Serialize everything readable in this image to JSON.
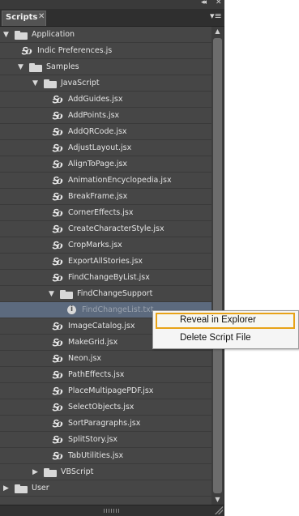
{
  "panel": {
    "tab_label": "Scripts",
    "tab_close_icon": "close-icon",
    "collapse_icon": "double-chevron-left-icon",
    "menu_icon": "panel-menu-icon"
  },
  "tree": {
    "rows": [
      {
        "label": "Application",
        "type": "folder",
        "expanded": true,
        "depth": 0
      },
      {
        "label": "Indic Preferences.js",
        "type": "script",
        "depth": 1
      },
      {
        "label": "Samples",
        "type": "folder",
        "expanded": true,
        "depth": 1
      },
      {
        "label": "JavaScript",
        "type": "folder",
        "expanded": true,
        "depth": 2
      },
      {
        "label": "AddGuides.jsx",
        "type": "script",
        "depth": 3
      },
      {
        "label": "AddPoints.jsx",
        "type": "script",
        "depth": 3
      },
      {
        "label": "AddQRCode.jsx",
        "type": "script",
        "depth": 3
      },
      {
        "label": "AdjustLayout.jsx",
        "type": "script",
        "depth": 3
      },
      {
        "label": "AlignToPage.jsx",
        "type": "script",
        "depth": 3
      },
      {
        "label": "AnimationEncyclopedia.jsx",
        "type": "script",
        "depth": 3
      },
      {
        "label": "BreakFrame.jsx",
        "type": "script",
        "depth": 3
      },
      {
        "label": "CornerEffects.jsx",
        "type": "script",
        "depth": 3
      },
      {
        "label": "CreateCharacterStyle.jsx",
        "type": "script",
        "depth": 3
      },
      {
        "label": "CropMarks.jsx",
        "type": "script",
        "depth": 3
      },
      {
        "label": "ExportAllStories.jsx",
        "type": "script",
        "depth": 3
      },
      {
        "label": "FindChangeByList.jsx",
        "type": "script",
        "depth": 3
      },
      {
        "label": "FindChangeSupport",
        "type": "folder",
        "expanded": true,
        "depth": 3
      },
      {
        "label": "FindChangeList.txt",
        "type": "info",
        "depth": 4,
        "selected": true
      },
      {
        "label": "ImageCatalog.jsx",
        "type": "script",
        "depth": 3
      },
      {
        "label": "MakeGrid.jsx",
        "type": "script",
        "depth": 3
      },
      {
        "label": "Neon.jsx",
        "type": "script",
        "depth": 3
      },
      {
        "label": "PathEffects.jsx",
        "type": "script",
        "depth": 3
      },
      {
        "label": "PlaceMultipagePDF.jsx",
        "type": "script",
        "depth": 3
      },
      {
        "label": "SelectObjects.jsx",
        "type": "script",
        "depth": 3
      },
      {
        "label": "SortParagraphs.jsx",
        "type": "script",
        "depth": 3
      },
      {
        "label": "SplitStory.jsx",
        "type": "script",
        "depth": 3
      },
      {
        "label": "TabUtilities.jsx",
        "type": "script",
        "depth": 3
      },
      {
        "label": "VBScript",
        "type": "folder",
        "expanded": false,
        "depth": 2
      },
      {
        "label": "User",
        "type": "folder",
        "expanded": false,
        "depth": 0
      }
    ]
  },
  "context_menu": {
    "items": [
      {
        "label": "Reveal in Explorer",
        "highlighted": true
      },
      {
        "label": "Delete Script File",
        "highlighted": false
      }
    ]
  },
  "colors": {
    "panel_bg": "#464646",
    "selected_row": "#5c6a7e",
    "menu_highlight_border": "#e8a317"
  }
}
